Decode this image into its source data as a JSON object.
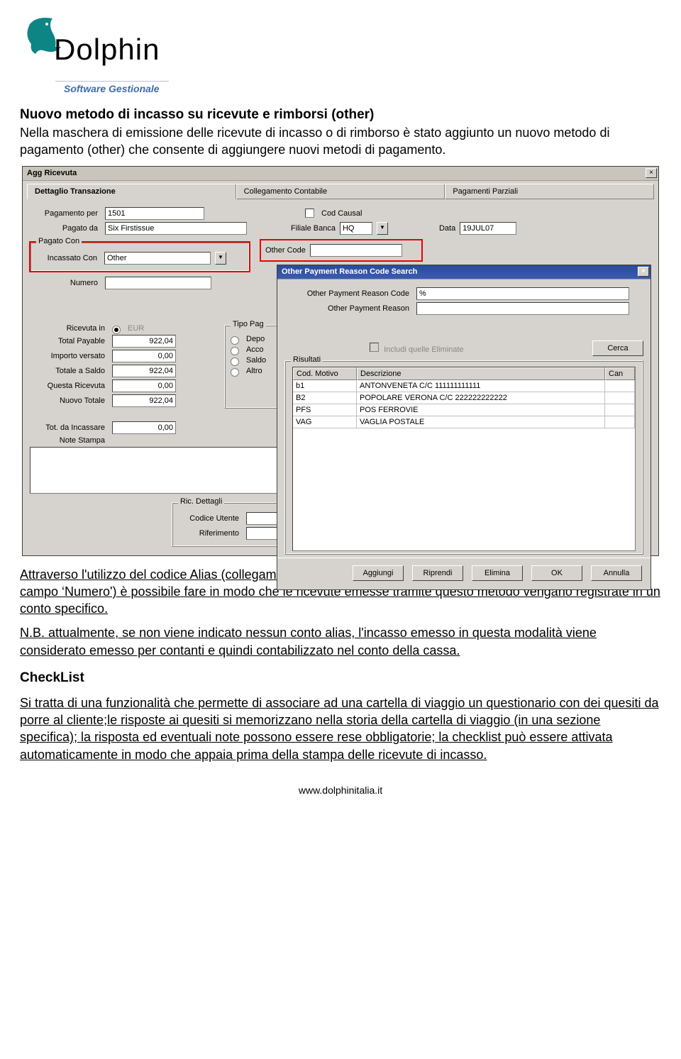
{
  "logo": {
    "brand": "Dolphin",
    "sub": "Software Gestionale"
  },
  "doc": {
    "title": "Nuovo metodo di incasso su ricevute e rimborsi (other)",
    "p1": "Nella maschera di emissione delle ricevute di incasso o di rimborso è stato aggiunto un nuovo metodo di pagamento (other) che consente di aggiungere nuovi metodi di pagamento.",
    "p2": "Attraverso l'utilizzo del codice Alias (collegamento del codice contabile in Dolphin Back Office da indicare nel campo ‘Numero') è possibile fare in modo che le ricevute emesse tramite questo metodo vengano registrate in un conto specifico.",
    "p3": "N.B. attualmente, se non viene indicato nessun conto alias, l'incasso emesso in questa modalità viene considerato emesso per contanti e quindi contabilizzato nel conto della cassa.",
    "checklist_h": "CheckList",
    "p4": "Si tratta di una funzionalità che permette di associare ad una cartella di viaggio un questionario con dei quesiti da porre al cliente;le risposte ai quesiti si memorizzano nella storia della cartella di viaggio (in una sezione specifica); la risposta ed eventuali note possono essere rese obbligatorie; la checklist può essere attivata automaticamente in modo che appaia prima della stampa delle ricevute di incasso."
  },
  "main": {
    "title": "Agg Ricevuta",
    "tabs": [
      "Dettaglio Transazione",
      "Collegamento Contabile",
      "Pagamenti Parziali"
    ],
    "labels": {
      "pagamento_per": "Pagamento per",
      "pagato_da": "Pagato da",
      "cod_causal": "Cod Causal",
      "filiale_banca": "Filiale Banca",
      "data": "Data",
      "incassato_con": "Incassato Con",
      "other_code": "Other Code",
      "numero": "Numero",
      "ricevuta_in": "Ricevuta in",
      "total_payable": "Total Payable",
      "importo_versato": "Importo versato",
      "totale_a_saldo": "Totale a Saldo",
      "questa_ricevuta": "Questa Ricevuta",
      "nuovo_totale": "Nuovo Totale",
      "tot_da_incassare": "Tot. da Incassare",
      "note_stampa": "Note Stampa",
      "ric_dettagli": "Ric. Dettagli",
      "codice_utente": "Codice Utente",
      "riferimento": "Riferimento",
      "pagato_con_legend": "Pagato Con",
      "tipo_pag_legend": "Tipo Pag",
      "depo": "Depo",
      "acco": "Acco",
      "saldo": "Saldo",
      "altro": "Altro"
    },
    "values": {
      "pagamento_per": "1501",
      "pagato_da": "Six Firstissue",
      "filiale_banca": "HQ",
      "data": "19JUL07",
      "incassato_con": "Other",
      "other_code": "",
      "numero": "",
      "currency": "EUR",
      "total_payable": "922,04",
      "importo_versato": "0,00",
      "totale_a_saldo": "922,04",
      "questa_ricevuta": "0,00",
      "nuovo_totale": "922,04",
      "tot_da_incassare": "0,00"
    }
  },
  "popup": {
    "title": "Other Payment Reason Code Search",
    "labels": {
      "code": "Other Payment Reason Code",
      "reason": "Other Payment Reason",
      "includi": "Includi quelle Eliminate",
      "risultati": "Risultati",
      "cerca": "Cerca",
      "col_code": "Cod. Motivo",
      "col_desc": "Descrizione",
      "col_can": "Can",
      "aggiungi": "Aggiungi",
      "riprendi": "Riprendi",
      "elimina": "Elimina",
      "ok": "OK",
      "annulla": "Annulla"
    },
    "values": {
      "code": "%",
      "reason": ""
    },
    "rows": [
      {
        "code": "b1",
        "desc": "ANTONVENETA C/C 111111111111"
      },
      {
        "code": "B2",
        "desc": "POPOLARE VERONA C/C 222222222222"
      },
      {
        "code": "PFS",
        "desc": "POS FERROVIE"
      },
      {
        "code": "VAG",
        "desc": "VAGLIA POSTALE"
      }
    ]
  },
  "footer": "www.dolphinitalia.it"
}
